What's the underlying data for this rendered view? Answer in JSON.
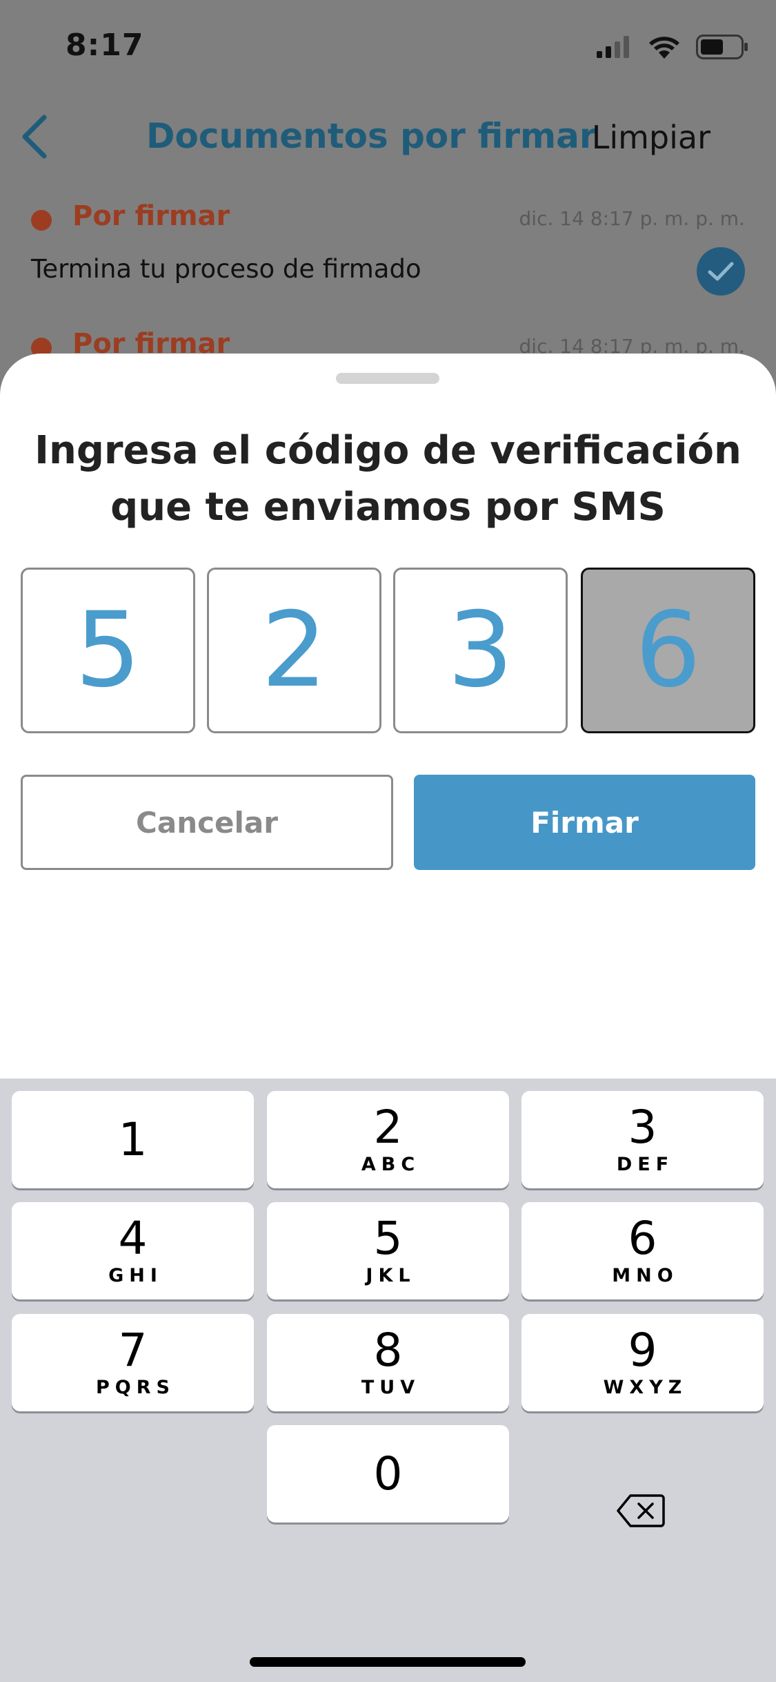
{
  "status_bar": {
    "time": "8:17"
  },
  "nav": {
    "back_icon": "chevron-left-icon",
    "title": "Documentos por firmar",
    "action": "Limpiar"
  },
  "notifications": [
    {
      "status": "Por firmar",
      "date": "dic. 14 8:17 p. m. p. m.",
      "body": "Termina tu proceso de firmado",
      "checked": true
    },
    {
      "status": "Por firmar",
      "date": "dic. 14 8:17 p. m. p. m."
    }
  ],
  "sheet": {
    "title": "Ingresa el código de verificación que te enviamos por SMS",
    "code_digits": [
      "5",
      "2",
      "3",
      "6"
    ],
    "active_digit_index": 3,
    "cancel_label": "Cancelar",
    "sign_label": "Firmar"
  },
  "keyboard": {
    "keys": [
      {
        "num": "1",
        "letters": ""
      },
      {
        "num": "2",
        "letters": "ABC"
      },
      {
        "num": "3",
        "letters": "DEF"
      },
      {
        "num": "4",
        "letters": "GHI"
      },
      {
        "num": "5",
        "letters": "JKL"
      },
      {
        "num": "6",
        "letters": "MNO"
      },
      {
        "num": "7",
        "letters": "PQRS"
      },
      {
        "num": "8",
        "letters": "TUV"
      },
      {
        "num": "9",
        "letters": "WXYZ"
      },
      {
        "num": "0",
        "letters": ""
      }
    ],
    "delete_icon": "backspace-icon"
  },
  "colors": {
    "accent": "#4697c8",
    "status_red": "#9c3d22",
    "title_blue": "#1f5c7a",
    "digit_blue": "#4a9ccd"
  }
}
